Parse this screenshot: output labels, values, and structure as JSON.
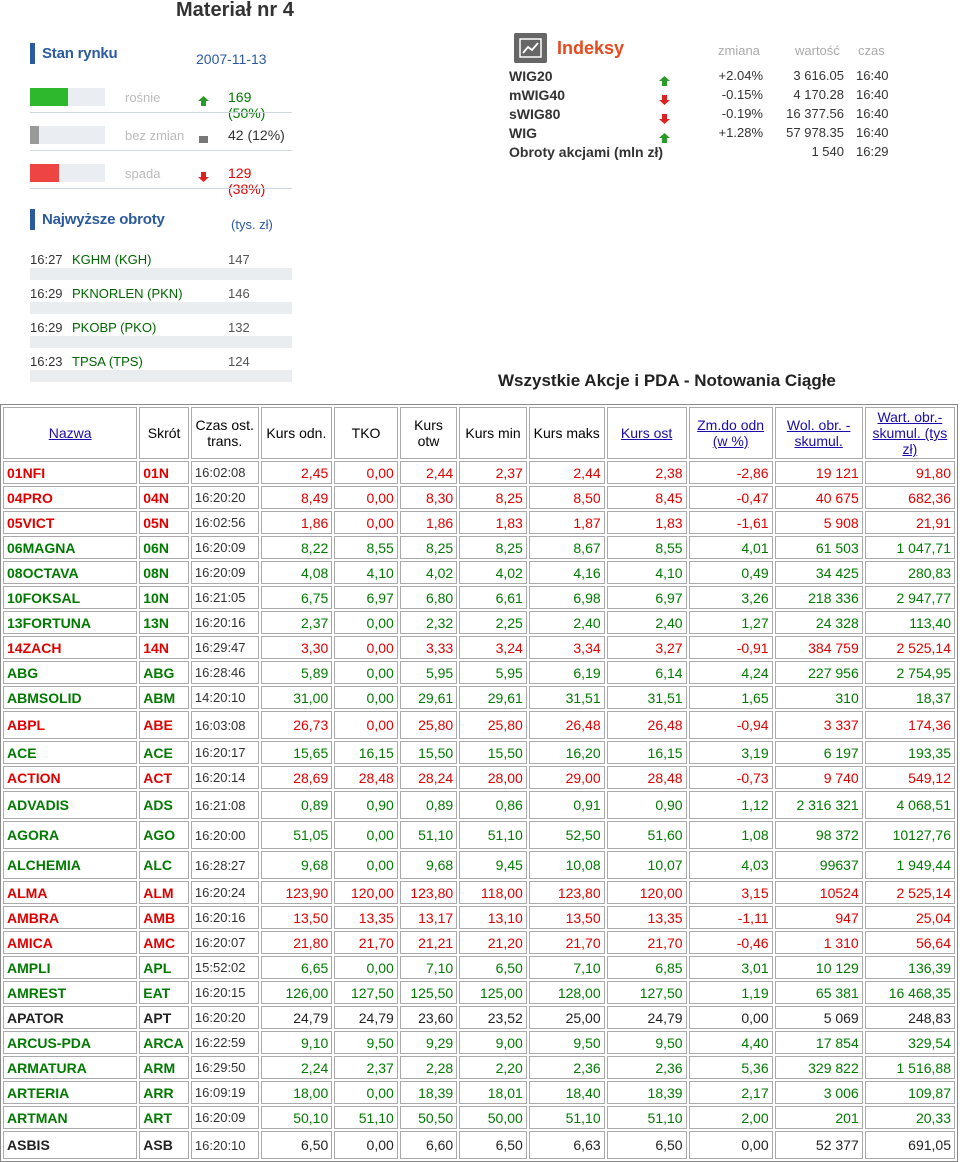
{
  "page": {
    "title": "Materiał nr 4"
  },
  "market": {
    "title": "Stan rynku",
    "date": "2007-11-13",
    "rows": [
      {
        "label": "rośnie",
        "value": "169 (50%)",
        "fraction": 0.5,
        "color": "#2db82d",
        "direction": "up"
      },
      {
        "label": "bez zmian",
        "value": "42 (12%)",
        "fraction": 0.12,
        "color": "#999999",
        "direction": "flat"
      },
      {
        "label": "spada",
        "value": "129 (38%)",
        "fraction": 0.38,
        "color": "#ee4444",
        "direction": "down"
      }
    ]
  },
  "turnover": {
    "title": "Najwyższe obroty",
    "unit": "(tys. zł)",
    "rows": [
      {
        "time": "16:27",
        "name": "KGHM (KGH)",
        "value": "147 198.79"
      },
      {
        "time": "16:29",
        "name": "PKNORLEN (PKN)",
        "value": "146 543.98"
      },
      {
        "time": "16:29",
        "name": "PKOBP (PKO)",
        "value": "132 659.01"
      },
      {
        "time": "16:23",
        "name": "TPSA (TPS)",
        "value": "124 121.33"
      }
    ]
  },
  "indices": {
    "title": "Indeksy",
    "headers": {
      "change": "zmiana",
      "value": "wartość",
      "time": "czas"
    },
    "rows": [
      {
        "name": "WIG20",
        "change": "+2.04%",
        "value": "3 616.05",
        "time": "16:40",
        "direction": "up"
      },
      {
        "name": "mWIG40",
        "change": "-0.15%",
        "value": "4 170.28",
        "time": "16:40",
        "direction": "down"
      },
      {
        "name": "sWIG80",
        "change": "-0.19%",
        "value": "16 377.56",
        "time": "16:40",
        "direction": "down"
      },
      {
        "name": "WIG",
        "change": "+1.28%",
        "value": "57 978.35",
        "time": "16:40",
        "direction": "up"
      },
      {
        "name": "Obroty akcjami (mln zł)",
        "change": "",
        "value": "1 540",
        "time": "16:29",
        "direction": ""
      }
    ]
  },
  "quotes": {
    "title": "Wszystkie Akcje i PDA - Notowania Ciągłe",
    "headers": [
      "Nazwa",
      "Skrót",
      "Czas ost. trans.",
      "Kurs odn.",
      "TKO",
      "Kurs otw",
      "Kurs min",
      "Kurs maks",
      "Kurs ost",
      "Zm.do odn (w %)",
      "Wol. obr. - skumul.",
      "Wart. obr.- skumul. (tys zł)"
    ],
    "rows": [
      [
        "01NFI",
        "01N",
        "16:02:08",
        "2,45",
        "0,00",
        "2,44",
        "2,37",
        "2,44",
        "2,38",
        "-2,86",
        "19 121",
        "91,80",
        "dn"
      ],
      [
        "04PRO",
        "04N",
        "16:20:20",
        "8,49",
        "0,00",
        "8,30",
        "8,25",
        "8,50",
        "8,45",
        "-0,47",
        "40 675",
        "682,36",
        "dn"
      ],
      [
        "05VICT",
        "05N",
        "16:02:56",
        "1,86",
        "0,00",
        "1,86",
        "1,83",
        "1,87",
        "1,83",
        "-1,61",
        "5 908",
        "21,91",
        "dn"
      ],
      [
        "06MAGNA",
        "06N",
        "16:20:09",
        "8,22",
        "8,55",
        "8,25",
        "8,25",
        "8,67",
        "8,55",
        "4,01",
        "61 503",
        "1 047,71",
        "up"
      ],
      [
        "08OCTAVA",
        "08N",
        "16:20:09",
        "4,08",
        "4,10",
        "4,02",
        "4,02",
        "4,16",
        "4,10",
        "0,49",
        "34 425",
        "280,83",
        "up"
      ],
      [
        "10FOKSAL",
        "10N",
        "16:21:05",
        "6,75",
        "6,97",
        "6,80",
        "6,61",
        "6,98",
        "6,97",
        "3,26",
        "218 336",
        "2 947,77",
        "up"
      ],
      [
        "13FORTUNA",
        "13N",
        "16:20:16",
        "2,37",
        "0,00",
        "2,32",
        "2,25",
        "2,40",
        "2,40",
        "1,27",
        "24 328",
        "113,40",
        "up"
      ],
      [
        "14ZACH",
        "14N",
        "16:29:47",
        "3,30",
        "0,00",
        "3,33",
        "3,24",
        "3,34",
        "3,27",
        "-0,91",
        "384 759",
        "2 525,14",
        "dn"
      ],
      [
        "ABG",
        "ABG",
        "16:28:46",
        "5,89",
        "0,00",
        "5,95",
        "5,95",
        "6,19",
        "6,14",
        "4,24",
        "227 956",
        "2 754,95",
        "up"
      ],
      [
        "ABMSOLID",
        "ABM",
        "14:20:10",
        "31,00",
        "0,00",
        "29,61",
        "29,61",
        "31,51",
        "31,51",
        "1,65",
        "310",
        "18,37",
        "up"
      ],
      [
        "ABPL",
        "ABE",
        "16:03:08",
        "26,73",
        "0,00",
        "25,80",
        "25,80",
        "26,48",
        "26,48",
        "-0,94",
        "3 337",
        "174,36",
        "dn"
      ],
      [
        "ACE",
        "ACE",
        "16:20:17",
        "15,65",
        "16,15",
        "15,50",
        "15,50",
        "16,20",
        "16,15",
        "3,19",
        "6 197",
        "193,35",
        "up"
      ],
      [
        "ACTION",
        "ACT",
        "16:20:14",
        "28,69",
        "28,48",
        "28,24",
        "28,00",
        "29,00",
        "28,48",
        "-0,73",
        "9 740",
        "549,12",
        "dn"
      ],
      [
        "ADVADIS",
        "ADS",
        "16:21:08",
        "0,89",
        "0,90",
        "0,89",
        "0,86",
        "0,91",
        "0,90",
        "1,12",
        "2 316 321",
        "4 068,51",
        "up"
      ],
      [
        "AGORA",
        "AGO",
        "16:20:00",
        "51,05",
        "0,00",
        "51,10",
        "51,10",
        "52,50",
        "51,60",
        "1,08",
        "98 372",
        "10127,76",
        "up"
      ],
      [
        "ALCHEMIA",
        "ALC",
        "16:28:27",
        "9,68",
        "0,00",
        "9,68",
        "9,45",
        "10,08",
        "10,07",
        "4,03",
        "99637",
        "1 949,44",
        "up"
      ],
      [
        "ALMA",
        "ALM",
        "16:20:24",
        "123,90",
        "120,00",
        "123,80",
        "118,00",
        "123,80",
        "120,00",
        "3,15",
        "10524",
        "2 525,14",
        "dn"
      ],
      [
        "AMBRA",
        "AMB",
        "16:20:16",
        "13,50",
        "13,35",
        "13,17",
        "13,10",
        "13,50",
        "13,35",
        "-1,11",
        "947",
        "25,04",
        "dn"
      ],
      [
        "AMICA",
        "AMC",
        "16:20:07",
        "21,80",
        "21,70",
        "21,21",
        "21,20",
        "21,70",
        "21,70",
        "-0,46",
        "1 310",
        "56,64",
        "dn"
      ],
      [
        "AMPLI",
        "APL",
        "15:52:02",
        "6,65",
        "0,00",
        "7,10",
        "6,50",
        "7,10",
        "6,85",
        "3,01",
        "10 129",
        "136,39",
        "up"
      ],
      [
        "AMREST",
        "EAT",
        "16:20:15",
        "126,00",
        "127,50",
        "125,50",
        "125,00",
        "128,00",
        "127,50",
        "1,19",
        "65 381",
        "16 468,35",
        "up"
      ],
      [
        "APATOR",
        "APT",
        "16:20:20",
        "24,79",
        "24,79",
        "23,60",
        "23,52",
        "25,00",
        "24,79",
        "0,00",
        "5 069",
        "248,83",
        "eq"
      ],
      [
        "ARCUS-PDA",
        "ARCA",
        "16:22:59",
        "9,10",
        "9,50",
        "9,29",
        "9,00",
        "9,50",
        "9,50",
        "4,40",
        "17 854",
        "329,54",
        "up"
      ],
      [
        "ARMATURA",
        "ARM",
        "16:29:50",
        "2,24",
        "2,37",
        "2,28",
        "2,20",
        "2,36",
        "2,36",
        "5,36",
        "329 822",
        "1 516,88",
        "up"
      ],
      [
        "ARTERIA",
        "ARR",
        "16:09:19",
        "18,00",
        "0,00",
        "18,39",
        "18,01",
        "18,40",
        "18,39",
        "2,17",
        "3 006",
        "109,87",
        "up"
      ],
      [
        "ARTMAN",
        "ART",
        "16:20:09",
        "50,10",
        "51,10",
        "50,50",
        "50,00",
        "51,10",
        "51,10",
        "2,00",
        "201",
        "20,33",
        "up"
      ],
      [
        "ASBIS",
        "ASB",
        "16:20:10",
        "6,50",
        "0,00",
        "6,60",
        "6,50",
        "6,63",
        "6,50",
        "0,00",
        "52 377",
        "691,05",
        "eq"
      ]
    ]
  }
}
